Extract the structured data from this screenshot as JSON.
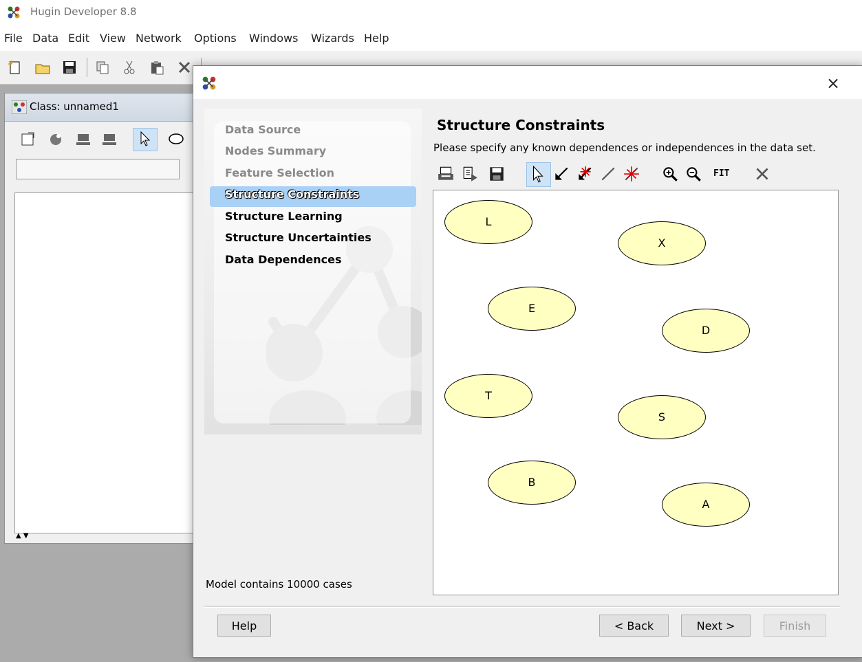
{
  "app": {
    "title": "Hugin Developer 8.8"
  },
  "menu": [
    "File",
    "Data",
    "Edit",
    "View",
    "Network",
    "Options",
    "Windows",
    "Wizards",
    "Help"
  ],
  "class_window": {
    "title": "Class: unnamed1"
  },
  "wizard": {
    "close_glyph": "×",
    "steps": {
      "data_source": "Data Source",
      "nodes_summary": "Nodes Summary",
      "feature_selection": "Feature Selection",
      "structure_constraints": "Structure Constraints",
      "structure_learning": "Structure Learning",
      "structure_uncertainties": "Structure Uncertainties",
      "data_dependences": "Data Dependences"
    },
    "section_title": "Structure Constraints",
    "section_description": "Please specify any known dependences or independences in the data set.",
    "fit_label": "FIT",
    "model_info": "Model contains 10000 cases",
    "nodes": [
      "L",
      "X",
      "E",
      "D",
      "T",
      "S",
      "B",
      "A"
    ],
    "buttons": {
      "help": "Help",
      "back": "< Back",
      "next": "Next >",
      "finish": "Finish"
    }
  }
}
